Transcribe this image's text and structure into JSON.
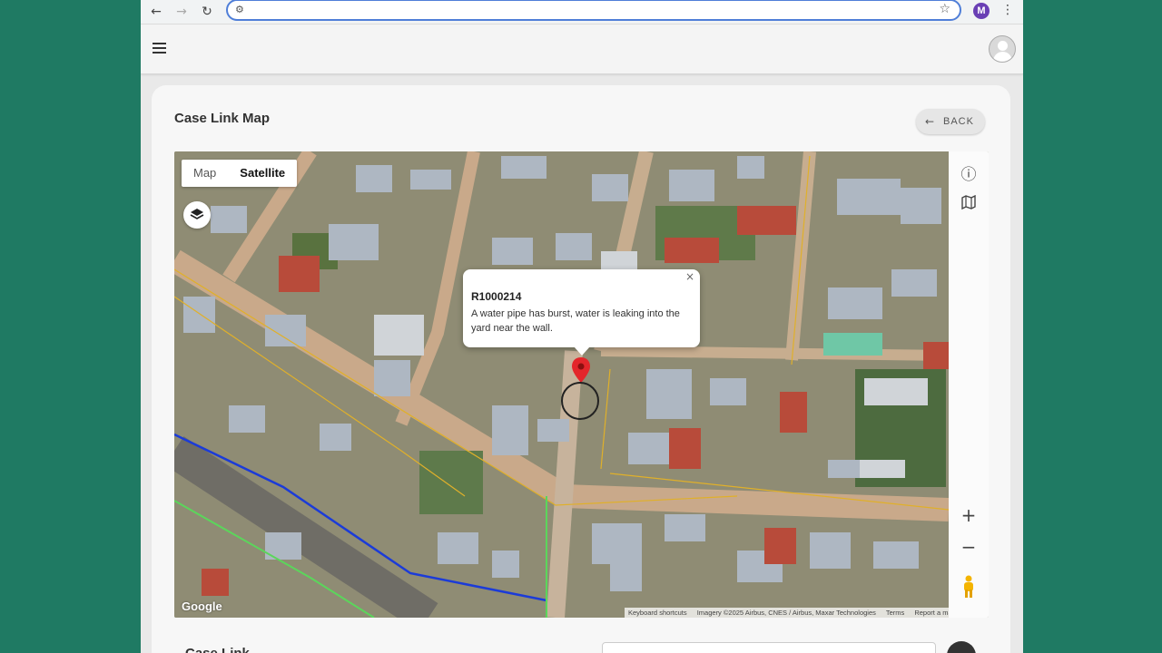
{
  "browser": {
    "back_icon": "←",
    "forward_icon": "→",
    "reload_icon": "↻",
    "profile_initial": "M",
    "menu_icon": "⋮",
    "star_icon": "☆",
    "site_settings_icon": "⚙"
  },
  "header": {
    "menu_icon": "hamburger-icon"
  },
  "page": {
    "title": "Case Link Map",
    "back_label": "BACK",
    "back_icon": "←"
  },
  "map": {
    "type_options": [
      "Map",
      "Satellite"
    ],
    "selected_type": "Satellite",
    "zoom_in": "+",
    "zoom_out": "−",
    "info_icon": "ⓘ",
    "map_icon": "map-icon",
    "google_logo": "Google",
    "attribution": {
      "shortcuts": "Keyboard shortcuts",
      "imagery": "Imagery ©2025 Airbus, CNES / Airbus, Maxar Technologies",
      "terms": "Terms",
      "report": "Report a map error"
    },
    "info_window": {
      "close": "×",
      "case_id": "R1000214",
      "description": "A water pipe has burst, water is leaking into the yard near the wall."
    }
  },
  "bottom": {
    "label": "Case Link"
  }
}
